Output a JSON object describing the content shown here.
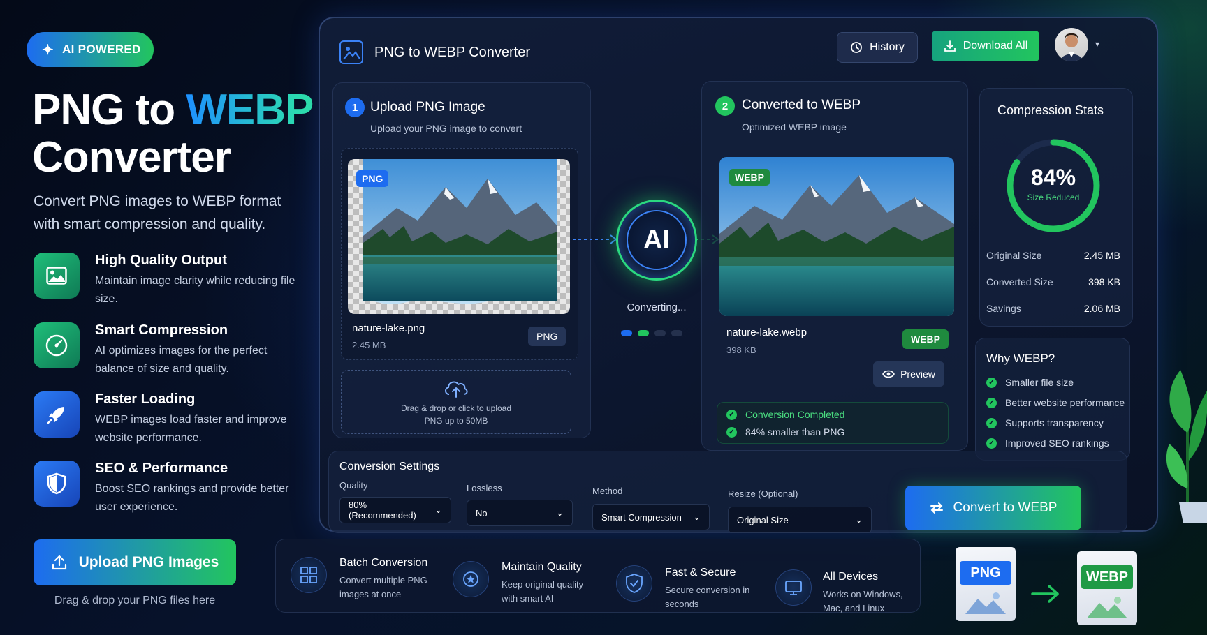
{
  "hero": {
    "badge": "AI POWERED",
    "title_line1_a": "PNG to ",
    "title_line1_b": "WEBP",
    "title_line2": "Converter",
    "subtitle": "Convert PNG images to WEBP format with smart compression and quality.",
    "features": [
      {
        "title": "High Quality Output",
        "desc": "Maintain image clarity while reducing file size.",
        "icon": "image-icon"
      },
      {
        "title": "Smart Compression",
        "desc": "AI optimizes images for the perfect balance of size and quality.",
        "icon": "gauge-icon"
      },
      {
        "title": "Faster Loading",
        "desc": "WEBP images load faster and improve website performance.",
        "icon": "rocket-icon"
      },
      {
        "title": "SEO & Performance",
        "desc": "Boost SEO rankings and provide better user experience.",
        "icon": "shield-icon"
      }
    ],
    "upload_button": "Upload PNG Images",
    "upload_hint": "Drag & drop your PNG files here"
  },
  "app": {
    "title": "PNG to WEBP Converter",
    "history": "History",
    "download_all": "Download All"
  },
  "upload": {
    "step": "1",
    "title": "Upload PNG Image",
    "subtitle": "Upload your PNG image to convert",
    "tag": "PNG",
    "filename": "nature-lake.png",
    "size": "2.45 MB",
    "format": "PNG",
    "drop_line1": "Drag & drop or click to upload",
    "drop_line2": "PNG up to 50MB"
  },
  "ai": {
    "label": "AI",
    "status": "Converting..."
  },
  "converted": {
    "step": "2",
    "title": "Converted to WEBP",
    "subtitle": "Optimized WEBP image",
    "tag": "WEBP",
    "filename": "nature-lake.webp",
    "size": "398 KB",
    "format": "WEBP",
    "preview": "Preview",
    "completed": "Conversion Completed",
    "smaller": "84% smaller than PNG"
  },
  "stats": {
    "title": "Compression Stats",
    "percent": "84%",
    "percent_value": 0.84,
    "percent_label": "Size Reduced",
    "rows": [
      {
        "label": "Original Size",
        "value": "2.45 MB"
      },
      {
        "label": "Converted Size",
        "value": "398 KB"
      },
      {
        "label": "Savings",
        "value": "2.06 MB"
      }
    ]
  },
  "why": {
    "title": "Why WEBP?",
    "items": [
      "Smaller file size",
      "Better website performance",
      "Supports transparency",
      "Improved SEO rankings"
    ]
  },
  "settings": {
    "title": "Conversion Settings",
    "quality_label": "Quality",
    "quality_value": "80% (Recommended)",
    "lossless_label": "Lossless",
    "lossless_value": "No",
    "method_label": "Method",
    "method_value": "Smart Compression",
    "resize_label": "Resize (Optional)",
    "resize_value": "Original Size",
    "convert_button": "Convert to WEBP"
  },
  "bottom": [
    {
      "title": "Batch Conversion",
      "desc": "Convert multiple PNG images at once",
      "icon": "batch-icon"
    },
    {
      "title": "Maintain Quality",
      "desc": "Keep original quality with smart AI",
      "icon": "quality-icon"
    },
    {
      "title": "Fast & Secure",
      "desc": "Secure conversion in seconds",
      "icon": "secure-shield-icon"
    },
    {
      "title": "All Devices",
      "desc": "Works on Windows, Mac, and Linux",
      "icon": "devices-icon"
    }
  ],
  "files": {
    "from": "PNG",
    "to": "WEBP"
  },
  "colors": {
    "blue": "#1d6cf0",
    "green": "#22c55e",
    "bg": "#06122a"
  }
}
